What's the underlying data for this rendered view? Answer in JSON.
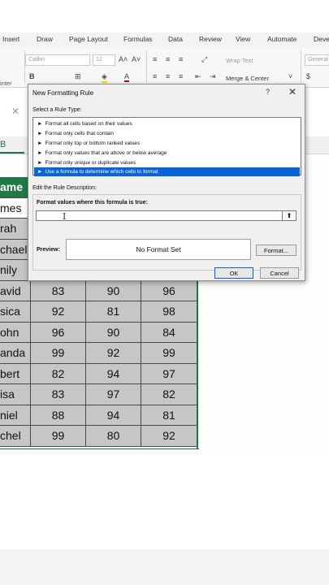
{
  "ribbon": {
    "tabs": [
      "Insert",
      "Draw",
      "Page Layout",
      "Formulas",
      "Data",
      "Review",
      "View",
      "Automate",
      "Deve"
    ],
    "font_name": "Calibri",
    "font_size": "12",
    "wrap_text": "Wrap Text",
    "merge_center": "Merge & Center",
    "number_format": "General",
    "left_cut_label": "inter"
  },
  "sheet": {
    "column_label": "B",
    "header_partial": "ame",
    "rows": [
      {
        "name": "mes",
        "v": [
          "",
          "",
          ""
        ]
      },
      {
        "name": "rah",
        "v": [
          "",
          "",
          ""
        ]
      },
      {
        "name": "chael",
        "v": [
          "",
          "",
          ""
        ]
      },
      {
        "name": "nily",
        "v": [
          "",
          "",
          ""
        ]
      },
      {
        "name": "avid",
        "v": [
          "83",
          "90",
          "96"
        ]
      },
      {
        "name": "sica",
        "v": [
          "92",
          "81",
          "98"
        ]
      },
      {
        "name": "ohn",
        "v": [
          "96",
          "90",
          "84"
        ]
      },
      {
        "name": "anda",
        "v": [
          "99",
          "92",
          "99"
        ]
      },
      {
        "name": "bert",
        "v": [
          "82",
          "94",
          "97"
        ]
      },
      {
        "name": "isa",
        "v": [
          "83",
          "97",
          "82"
        ]
      },
      {
        "name": "niel",
        "v": [
          "88",
          "94",
          "81"
        ]
      },
      {
        "name": "chel",
        "v": [
          "99",
          "80",
          "92"
        ]
      }
    ]
  },
  "dialog": {
    "title": "New Formatting Rule",
    "help": "?",
    "close": "✕",
    "select_rule_label": "Select a Rule Type:",
    "rules": [
      "Format all cells based on their values",
      "Format only cells that contain",
      "Format only top or bottom ranked values",
      "Format only values that are above or below average",
      "Format only unique or duplicate values",
      "Use a formula to determine which cells to format"
    ],
    "selected_index": 5,
    "edit_label": "Edit the Rule Description:",
    "formula_label": "Format values where this formula is true:",
    "formula_value": "",
    "preview_label": "Preview:",
    "preview_text": "No Format Set",
    "format_button": "Format...",
    "ok_button": "OK",
    "cancel_button": "Cancel"
  }
}
